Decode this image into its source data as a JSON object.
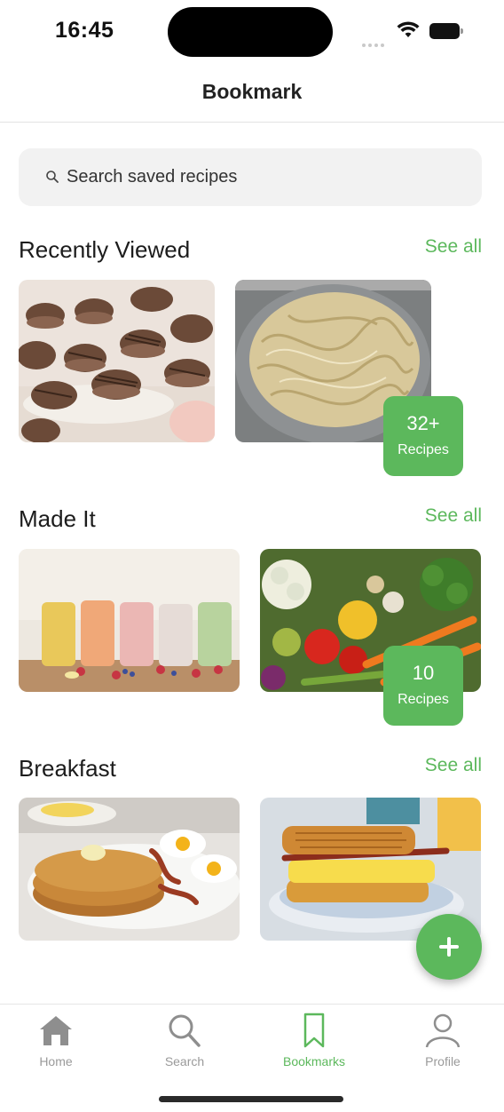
{
  "status_bar": {
    "time": "16:45"
  },
  "header": {
    "title": "Bookmark"
  },
  "search": {
    "placeholder": "Search saved recipes"
  },
  "sections": [
    {
      "title": "Recently Viewed",
      "see_all": "See all",
      "cards": [
        {
          "image": "chocolate macarons"
        },
        {
          "image": "fettuccine alfredo"
        }
      ],
      "badge": {
        "count": "32+",
        "label": "Recipes"
      }
    },
    {
      "title": "Made It",
      "see_all": "See all",
      "cards": [
        {
          "image": "smoothie jars"
        },
        {
          "image": "fresh vegetables"
        }
      ],
      "badge": {
        "count": "10",
        "label": "Recipes"
      }
    },
    {
      "title": "Breakfast",
      "see_all": "See all",
      "cards": [
        {
          "image": "pancakes with eggs and bacon"
        },
        {
          "image": "hash brown breakfast sandwich"
        }
      ]
    }
  ],
  "fab": {
    "icon": "plus-icon"
  },
  "tab_bar": {
    "items": [
      {
        "label": "Home",
        "icon": "home-icon",
        "active": false
      },
      {
        "label": "Search",
        "icon": "search-icon",
        "active": false
      },
      {
        "label": "Bookmarks",
        "icon": "bookmark-icon",
        "active": true
      },
      {
        "label": "Profile",
        "icon": "profile-icon",
        "active": false
      }
    ]
  },
  "colors": {
    "accent": "#5cb85c",
    "search_bg": "#f2f2f2",
    "inactive_tab": "#9a9a9a"
  }
}
